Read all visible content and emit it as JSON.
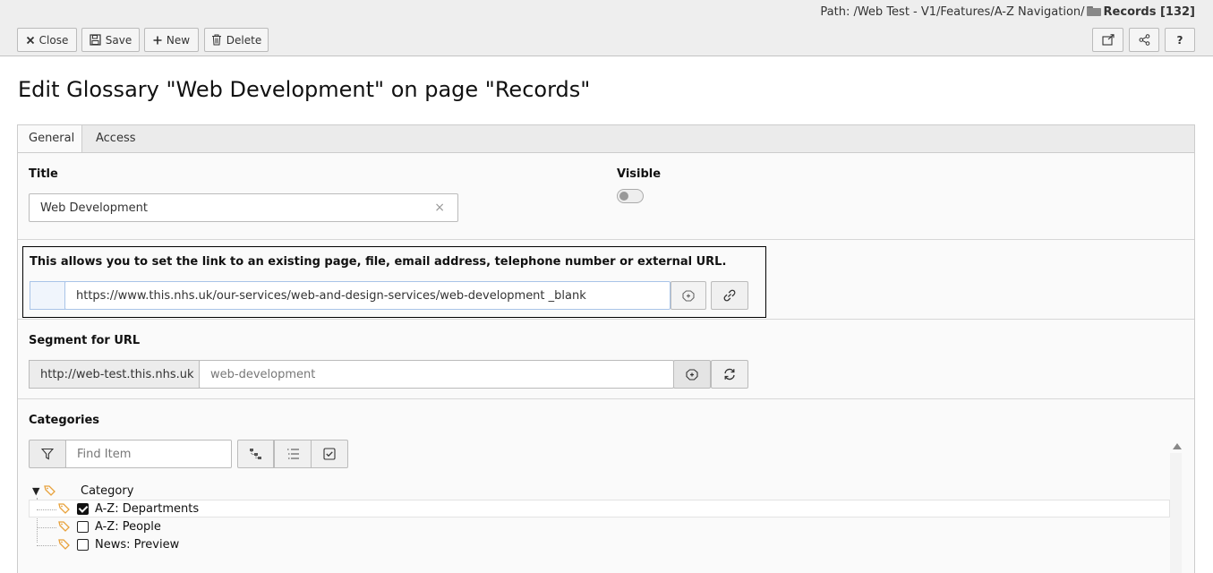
{
  "header": {
    "path_prefix": "Path: /Web Test - V1/Features/A-Z Navigation/",
    "record_label": "Records [132]"
  },
  "toolbar": {
    "close_label": "Close",
    "save_label": "Save",
    "new_label": "New",
    "delete_label": "Delete",
    "open_new_window_icon": "external-window-icon",
    "share_icon": "share-icon",
    "help_label": "?"
  },
  "page": {
    "title": "Edit Glossary \"Web Development\" on page \"Records\""
  },
  "tabs": [
    {
      "label": "General",
      "active": true
    },
    {
      "label": "Access",
      "active": false
    }
  ],
  "form": {
    "title_label": "Title",
    "title_value": "Web Development",
    "visible_label": "Visible",
    "visible_on": false,
    "link_help": "This allows you to set the link to an existing page, file, email address, telephone number or external URL.",
    "link_value": "https://www.this.nhs.uk/our-services/web-and-design-services/web-development _blank",
    "segment_label": "Segment for URL",
    "segment_prefix": "http://web-test.this.nhs.uk",
    "segment_value": "web-development",
    "categories_label": "Categories",
    "find_placeholder": "Find Item"
  },
  "tree": {
    "root_label": "Category",
    "items": [
      {
        "label": "A-Z: Departments",
        "checked": true
      },
      {
        "label": "A-Z: People",
        "checked": false
      },
      {
        "label": "News: Preview",
        "checked": false
      }
    ]
  },
  "colors": {
    "header_bg": "#eeeeee",
    "panel_bg": "#fafafa",
    "tag_orange": "#e8a23c",
    "link_focus": "#a9c4e8"
  }
}
